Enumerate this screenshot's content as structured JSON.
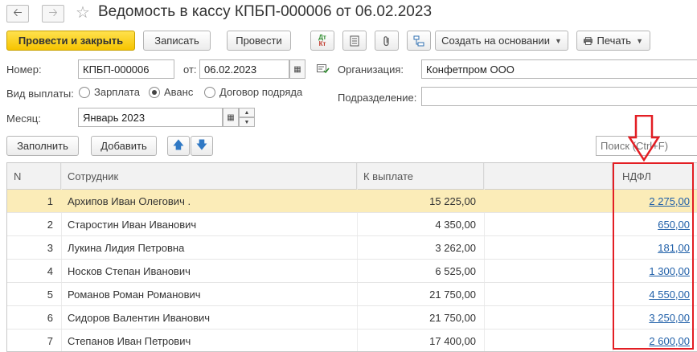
{
  "window": {
    "title": "Ведомость в кассу КПБП-000006 от 06.02.2023"
  },
  "icons": {
    "back": "arrow-left-icon",
    "forward": "arrow-right-icon",
    "favorite": "star-icon"
  },
  "toolbar": {
    "post_close_label": "Провести и закрыть",
    "save_label": "Записать",
    "post_label": "Провести",
    "dt_kt_label_top": "Дт",
    "dt_kt_label_bottom": "Кт",
    "create_based_label": "Создать на основании",
    "print_label": "Печать"
  },
  "form": {
    "number_label": "Номер:",
    "number_value": "КПБП-000006",
    "date_label": "от:",
    "date_value": "06.02.2023",
    "org_label": "Организация:",
    "org_value": "Конфетпром ООО",
    "payment_type_label": "Вид выплаты:",
    "payment_types": [
      {
        "label": "Зарплата",
        "selected": false
      },
      {
        "label": "Аванс",
        "selected": true
      },
      {
        "label": "Договор подряда",
        "selected": false
      }
    ],
    "subdivision_label": "Подразделение:",
    "subdivision_value": "",
    "month_label": "Месяц:",
    "month_value": "Январь 2023"
  },
  "table_toolbar": {
    "fill_label": "Заполнить",
    "add_label": "Добавить",
    "search_placeholder": "Поиск (Ctrl+F)"
  },
  "table": {
    "columns": [
      "N",
      "Сотрудник",
      "К выплате",
      "НДФЛ"
    ],
    "rows": [
      {
        "n": "1",
        "employee": "Архипов Иван Олегович .",
        "payout": "15 225,00",
        "ndfl": "2 275,00"
      },
      {
        "n": "2",
        "employee": "Старостин Иван Иванович",
        "payout": "4 350,00",
        "ndfl": "650,00"
      },
      {
        "n": "3",
        "employee": "Лукина Лидия Петровна",
        "payout": "3 262,00",
        "ndfl": "181,00"
      },
      {
        "n": "4",
        "employee": "Носков Степан Иванович",
        "payout": "6 525,00",
        "ndfl": "1 300,00"
      },
      {
        "n": "5",
        "employee": "Романов Роман Романович",
        "payout": "21 750,00",
        "ndfl": "4 550,00"
      },
      {
        "n": "6",
        "employee": "Сидоров Валентин Иванович",
        "payout": "21 750,00",
        "ndfl": "3 250,00"
      },
      {
        "n": "7",
        "employee": "Степанов Иван Петрович",
        "payout": "17 400,00",
        "ndfl": "2 600,00"
      }
    ]
  },
  "colors": {
    "primary_button": "#f6c400",
    "selected_row": "#fbecb8",
    "link": "#1f5fa8",
    "highlight": "#e31e24"
  }
}
